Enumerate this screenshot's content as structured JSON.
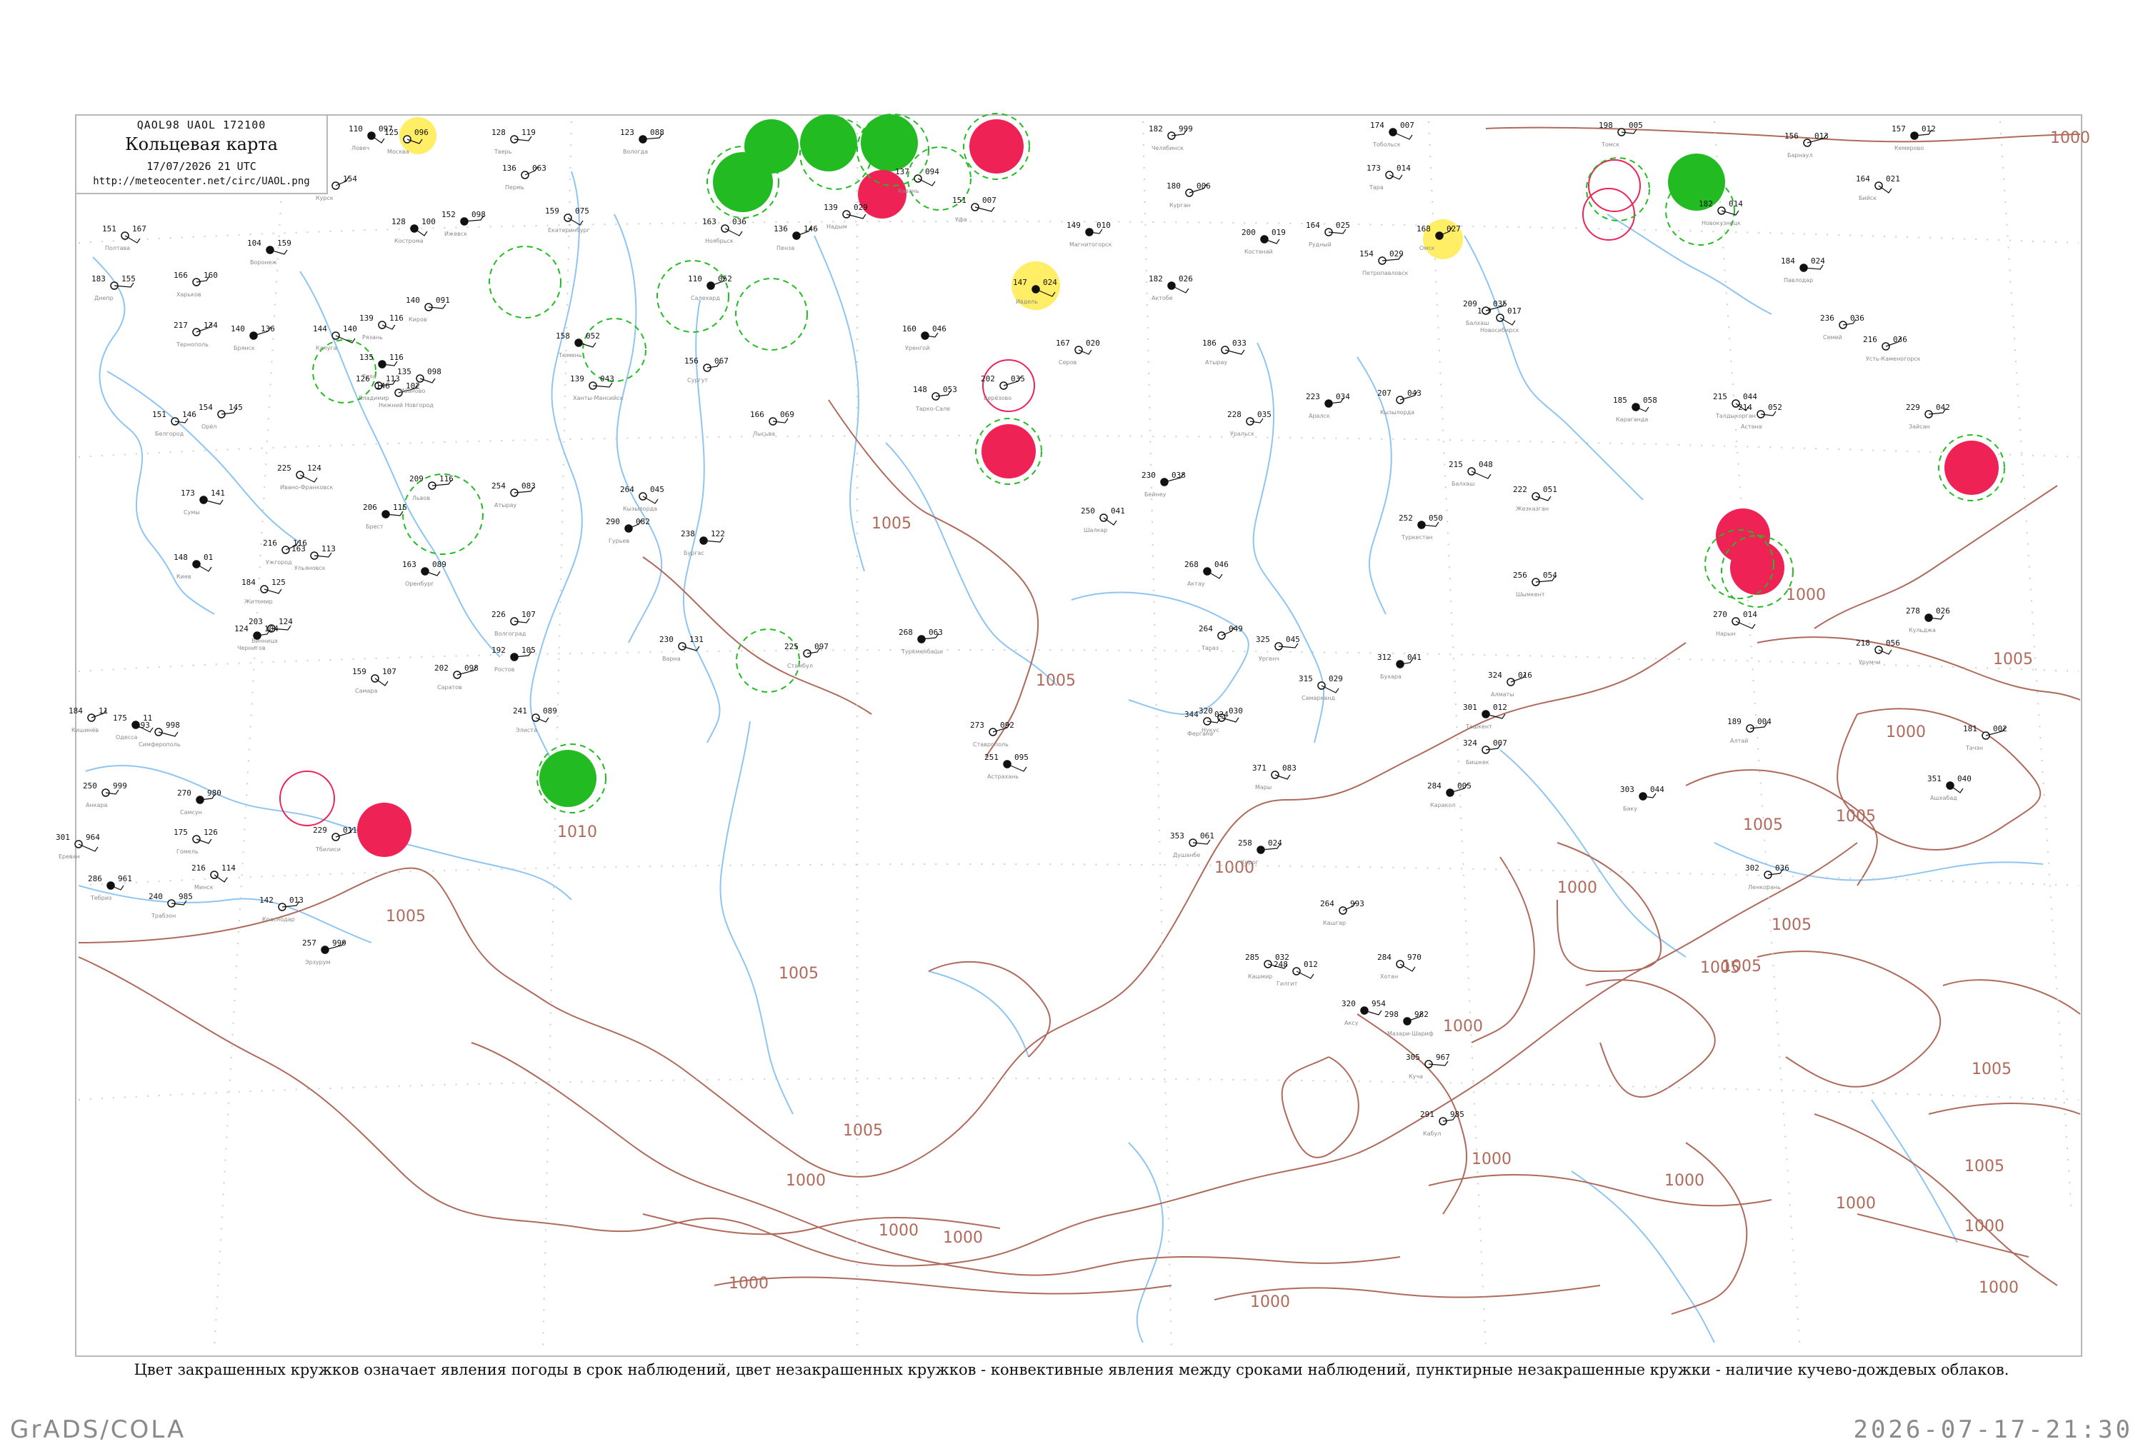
{
  "title_box": {
    "code": "QAOL98  UAOL  172100",
    "title": "Кольцевая карта",
    "datetime": "17/07/2026 21 UTC",
    "url": "http://meteocenter.net/circ/UAOL.png"
  },
  "caption": "Цвет закрашенных кружков означает явления погоды в срок наблюдений, цвет незакрашенных кружков - конвективные явления между сроками наблюдений, пунктирные незакрашенные кружки - наличие кучево-дождевых облаков.",
  "footer": {
    "credit": "GrADS/COLA",
    "datestamp": "2026-07-17-21:30"
  },
  "colors": {
    "isobar": "#b06a5c",
    "river": "#8ec5f2",
    "frame": "#b8b8b8",
    "thunder_fill": "#22bb22",
    "rain_fill": "#ee2255",
    "fog_fill": "#ffee66"
  },
  "isobar_labels": [
    "1000",
    "1005",
    "1010",
    "1000",
    "1005",
    "1005",
    "1005",
    "1005",
    "1000",
    "1005",
    "1000",
    "1005",
    "1000",
    "1005",
    "1000",
    "1005",
    "1000",
    "1005",
    "1000",
    "1000",
    "1005",
    "1000",
    "1005",
    "1000",
    "1000",
    "1005",
    "1000",
    "1000",
    "1000",
    "1000"
  ],
  "stations": [
    {
      "t": "110",
      "p": "097",
      "n": "Ловеч"
    },
    {
      "t": "125",
      "p": "096",
      "n": "Москва"
    },
    {
      "t": "128",
      "p": "119",
      "n": "Тверь"
    },
    {
      "t": "123",
      "p": "088",
      "n": "Вологда"
    },
    {
      "t": "112",
      "p": "154",
      "n": "Курск"
    },
    {
      "t": "151",
      "p": "167",
      "n": "Полтава"
    },
    {
      "t": "104",
      "p": "159",
      "n": "Воронеж"
    },
    {
      "t": "183",
      "p": "155",
      "n": "Днепр"
    },
    {
      "t": "166",
      "p": "160",
      "n": "Харьков"
    },
    {
      "t": "136",
      "p": "146",
      "n": "Пенза"
    },
    {
      "t": "137",
      "p": "094",
      "n": "Казань"
    },
    {
      "t": "151",
      "p": "007",
      "n": "Уфа"
    },
    {
      "t": "149",
      "p": "010",
      "n": "Магнитогорск"
    },
    {
      "t": "182",
      "p": "999",
      "n": "Челябинск"
    },
    {
      "t": "180",
      "p": "006",
      "n": "Курган"
    },
    {
      "t": "174",
      "p": "007",
      "n": "Тобольск"
    },
    {
      "t": "173",
      "p": "014",
      "n": "Тара"
    },
    {
      "t": "198",
      "p": "005",
      "n": "Томск"
    },
    {
      "t": "157",
      "p": "012",
      "n": "Кемерово"
    },
    {
      "t": "156",
      "p": "013",
      "n": "Барнаул"
    },
    {
      "t": "164",
      "p": "021",
      "n": "Бийск"
    },
    {
      "t": "200",
      "p": "019",
      "n": "Костанай"
    },
    {
      "t": "164",
      "p": "025",
      "n": "Рудный"
    },
    {
      "t": "154",
      "p": "029",
      "n": "Петропавловск"
    },
    {
      "t": "168",
      "p": "027",
      "n": "Омск"
    },
    {
      "t": "179",
      "p": "017",
      "n": "Новосибирск"
    },
    {
      "t": "182",
      "p": "014",
      "n": "Новокузнецк"
    },
    {
      "t": "184",
      "p": "024",
      "n": "Павлодар"
    },
    {
      "t": "236",
      "p": "036",
      "n": "Семей"
    },
    {
      "t": "216",
      "p": "036",
      "n": "Усть-Каменогорск"
    },
    {
      "t": "182",
      "p": "026",
      "n": "Актобе"
    },
    {
      "t": "186",
      "p": "033",
      "n": "Атырау"
    },
    {
      "t": "228",
      "p": "035",
      "n": "Уральск"
    },
    {
      "t": "223",
      "p": "034",
      "n": "Аралск"
    },
    {
      "t": "207",
      "p": "043",
      "n": "Кызылорда"
    },
    {
      "t": "215",
      "p": "048",
      "n": "Балхаш"
    },
    {
      "t": "185",
      "p": "058",
      "n": "Караганда"
    },
    {
      "t": "214",
      "p": "052",
      "n": "Астана"
    },
    {
      "t": "229",
      "p": "042",
      "n": "Зайсан"
    },
    {
      "t": "230",
      "p": "038",
      "n": "Бейнеу"
    },
    {
      "t": "250",
      "p": "041",
      "n": "Шалкар"
    },
    {
      "t": "222",
      "p": "051",
      "n": "Жезказган"
    },
    {
      "t": "252",
      "p": "050",
      "n": "Туркестан"
    },
    {
      "t": "256",
      "p": "054",
      "n": "Шымкент"
    },
    {
      "t": "264",
      "p": "049",
      "n": "Тараз"
    },
    {
      "t": "268",
      "p": "046",
      "n": "Актау"
    },
    {
      "t": "320",
      "p": "030",
      "n": "Нукус"
    },
    {
      "t": "325",
      "p": "045",
      "n": "Ургенч"
    },
    {
      "t": "312",
      "p": "041",
      "n": "Бухара"
    },
    {
      "t": "324",
      "p": "016",
      "n": "Алматы"
    },
    {
      "t": "315",
      "p": "029",
      "n": "Самарканд"
    },
    {
      "t": "301",
      "p": "012",
      "n": "Ташкент"
    },
    {
      "t": "344",
      "p": "024",
      "n": "Фергана"
    },
    {
      "t": "324",
      "p": "007",
      "n": "Бишкек"
    },
    {
      "t": "284",
      "p": "005",
      "n": "Каракол"
    },
    {
      "t": "270",
      "p": "014",
      "n": "Нарын"
    },
    {
      "t": "218",
      "p": "056",
      "n": "Урумчи"
    },
    {
      "t": "278",
      "p": "026",
      "n": "Кульджа"
    },
    {
      "t": "189",
      "p": "004",
      "n": "Алтай"
    },
    {
      "t": "181",
      "p": "002",
      "n": "Тачэн"
    },
    {
      "t": "351",
      "p": "040",
      "n": "Ашхабад"
    },
    {
      "t": "371",
      "p": "083",
      "n": "Мары"
    },
    {
      "t": "353",
      "p": "061",
      "n": "Душанбе"
    },
    {
      "t": "258",
      "p": "024",
      "n": "Хорог"
    },
    {
      "t": "264",
      "p": "993",
      "n": "Кашгар"
    },
    {
      "t": "284",
      "p": "970",
      "n": "Хотан"
    },
    {
      "t": "320",
      "p": "954",
      "n": "Аксу"
    },
    {
      "t": "305",
      "p": "967",
      "n": "Куча"
    },
    {
      "t": "291",
      "p": "985",
      "n": "Кабул"
    },
    {
      "t": "298",
      "p": "982",
      "n": "Мазари-Шариф"
    },
    {
      "t": "248",
      "p": "012",
      "n": "Гилгит"
    },
    {
      "t": "285",
      "p": "032",
      "n": "Кашмир"
    },
    {
      "t": "303",
      "p": "044",
      "n": "Баку"
    },
    {
      "t": "302",
      "p": "036",
      "n": "Ленкорань"
    },
    {
      "t": "273",
      "p": "092",
      "n": "Ставрополь"
    },
    {
      "t": "251",
      "p": "095",
      "n": "Астрахань"
    },
    {
      "t": "241",
      "p": "089",
      "n": "Элиста"
    },
    {
      "t": "226",
      "p": "107",
      "n": "Волгоград"
    },
    {
      "t": "192",
      "p": "105",
      "n": "Ростов"
    },
    {
      "t": "202",
      "p": "098",
      "n": "Саратов"
    },
    {
      "t": "159",
      "p": "107",
      "n": "Самара"
    },
    {
      "t": "163",
      "p": "089",
      "n": "Оренбург"
    },
    {
      "t": "163",
      "p": "113",
      "n": "Ульяновск"
    },
    {
      "t": "254",
      "p": "083",
      "n": "Атырау"
    },
    {
      "t": "290",
      "p": "082",
      "n": "Гурьев"
    },
    {
      "t": "264",
      "p": "045",
      "n": "Кызылорда"
    },
    {
      "t": "230",
      "p": "131",
      "n": "Варна"
    },
    {
      "t": "238",
      "p": "122",
      "n": "Бургас"
    },
    {
      "t": "225",
      "p": "097",
      "n": "Стамбул"
    },
    {
      "t": "184",
      "p": "11",
      "n": "Кишинёв"
    },
    {
      "t": "175",
      "p": "11",
      "n": "Одесса"
    },
    {
      "t": "193",
      "p": "998",
      "n": "Симферополь"
    },
    {
      "t": "250",
      "p": "999",
      "n": "Анкара"
    },
    {
      "t": "270",
      "p": "980",
      "n": "Самсун"
    },
    {
      "t": "229",
      "p": "011",
      "n": "Тбилиси"
    },
    {
      "t": "301",
      "p": "964",
      "n": "Ереван"
    },
    {
      "t": "286",
      "p": "961",
      "n": "Тебриз"
    },
    {
      "t": "240",
      "p": "985",
      "n": "Трабзон"
    },
    {
      "t": "142",
      "p": "013",
      "n": "Краснодар"
    },
    {
      "t": "257",
      "p": "999",
      "n": "Эрзурум"
    },
    {
      "t": "216",
      "p": "114",
      "n": "Минск"
    },
    {
      "t": "175",
      "p": "126",
      "n": "Гомель"
    },
    {
      "t": "206",
      "p": "115",
      "n": "Брест"
    },
    {
      "t": "209",
      "p": "116",
      "n": "Львов"
    },
    {
      "t": "216",
      "p": "116",
      "n": "Ужгород"
    },
    {
      "t": "148",
      "p": "01",
      "n": "Киев"
    },
    {
      "t": "184",
      "p": "125",
      "n": "Житомир"
    },
    {
      "t": "203",
      "p": "124",
      "n": "Винница"
    },
    {
      "t": "124",
      "p": "104",
      "n": "Чернигов"
    },
    {
      "t": "217",
      "p": "134",
      "n": "Тернополь"
    },
    {
      "t": "225",
      "p": "124",
      "n": "Ивано-Франковск"
    },
    {
      "t": "173",
      "p": "141",
      "n": "Сумы"
    },
    {
      "t": "151",
      "p": "146",
      "n": "Белгород"
    },
    {
      "t": "154",
      "p": "145",
      "n": "Орёл"
    },
    {
      "t": "140",
      "p": "136",
      "n": "Брянск"
    },
    {
      "t": "144",
      "p": "140",
      "n": "Калуга"
    },
    {
      "t": "139",
      "p": "116",
      "n": "Рязань"
    },
    {
      "t": "135",
      "p": "116",
      "n": "Тула"
    },
    {
      "t": "126",
      "p": "113",
      "n": "Владимир"
    },
    {
      "t": "146",
      "p": "102",
      "n": "Нижний Новгород"
    },
    {
      "t": "128",
      "p": "100",
      "n": "Кострома"
    },
    {
      "t": "135",
      "p": "098",
      "n": "Иваново"
    },
    {
      "t": "140",
      "p": "091",
      "n": "Киров"
    },
    {
      "t": "152",
      "p": "098",
      "n": "Ижевск"
    },
    {
      "t": "136",
      "p": "063",
      "n": "Пермь"
    },
    {
      "t": "159",
      "p": "075",
      "n": "Екатеринбург"
    },
    {
      "t": "158",
      "p": "052",
      "n": "Тюмень"
    },
    {
      "t": "139",
      "p": "043",
      "n": "Ханты-Мансийск"
    },
    {
      "t": "156",
      "p": "067",
      "n": "Сургут"
    },
    {
      "t": "110",
      "p": "052",
      "n": "Салехард"
    },
    {
      "t": "163",
      "p": "036",
      "n": "Ноябрьск"
    },
    {
      "t": "139",
      "p": "029",
      "n": "Надым"
    },
    {
      "t": "160",
      "p": "046",
      "n": "Уренгой"
    },
    {
      "t": "148",
      "p": "053",
      "n": "Тарко-Сале"
    },
    {
      "t": "202",
      "p": "035",
      "n": "Берёзово"
    },
    {
      "t": "147",
      "p": "024",
      "n": "Ивдель"
    },
    {
      "t": "167",
      "p": "020",
      "n": "Серов"
    },
    {
      "t": "166",
      "p": "069",
      "n": "Лысьва"
    },
    {
      "t": "268",
      "p": "063",
      "n": "Туркменбаши"
    },
    {
      "t": "209",
      "p": "035",
      "n": "Балхаш"
    },
    {
      "t": "215",
      "p": "044",
      "n": "Талдыкорган"
    }
  ]
}
